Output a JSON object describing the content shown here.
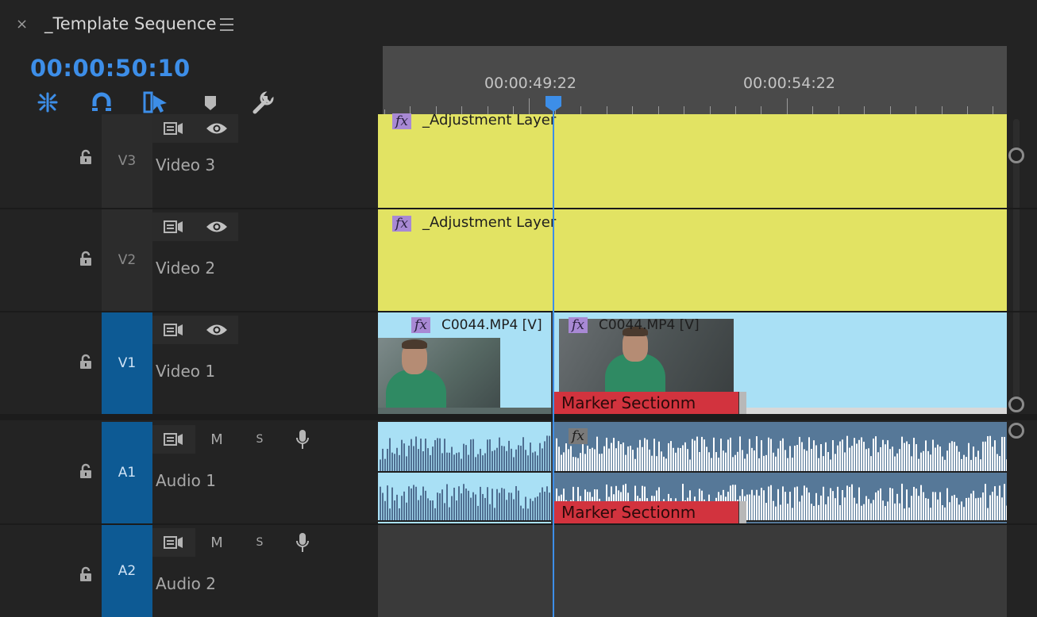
{
  "panel": {
    "close": "×",
    "title": "_Template Sequence"
  },
  "playhead_timecode": "00:00:50:10",
  "ruler": {
    "labels": [
      "00:00:49:22",
      "00:00:54:22"
    ]
  },
  "tools": [
    "snap-icon",
    "linked-selection-icon",
    "insert-overwrite-icon",
    "add-marker-icon",
    "timeline-settings-icon"
  ],
  "tracks": {
    "v3": {
      "code": "V3",
      "name": "Video 3"
    },
    "v2": {
      "code": "V2",
      "name": "Video 2"
    },
    "v1": {
      "code": "V1",
      "name": "Video 1"
    },
    "a1": {
      "code": "A1",
      "name": "Audio 1",
      "mute": "M",
      "solo": "S"
    },
    "a2": {
      "code": "A2",
      "name": "Audio 2",
      "mute": "M",
      "solo": "S"
    }
  },
  "clips": {
    "adj1": {
      "fx": "fx",
      "label": "_Adjustment Layer"
    },
    "adj2": {
      "fx": "fx",
      "label": "_Adjustment Layer"
    },
    "v1_left": {
      "fx": "fx",
      "label": "C0044.MP4 [V]"
    },
    "v1_right": {
      "fx": "fx",
      "label": "C0044.MP4 [V]"
    },
    "a1_right_fx": "fx"
  },
  "markers": {
    "video": "Marker Sectionm",
    "audio": "Marker Sectionm"
  },
  "colors": {
    "accent": "#3d8ee8",
    "adjustment": "#e2e363",
    "video_clip": "#a9e0f5",
    "audio_clip": "#567898",
    "marker": "#d2333e",
    "track_target": "#0d5a94",
    "fx_badge": "#a889d4"
  }
}
